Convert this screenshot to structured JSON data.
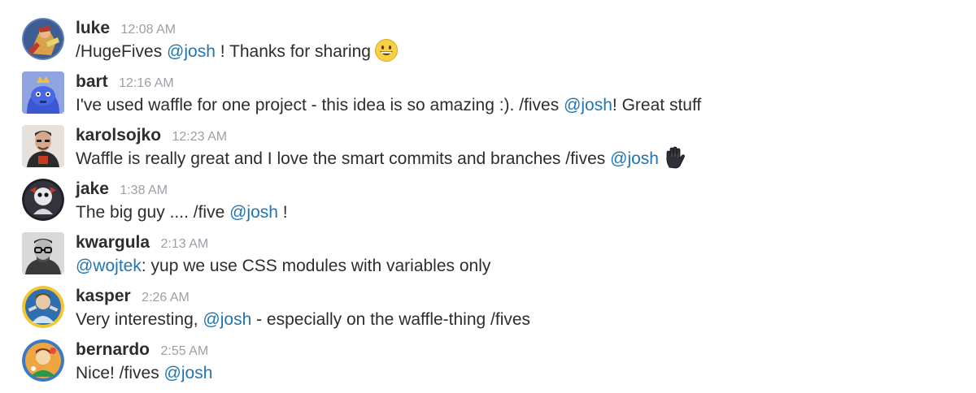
{
  "messages": [
    {
      "username": "luke",
      "time": "12:08 AM",
      "parts": [
        "/HugeFives ",
        "@josh",
        " ! Thanks for sharing"
      ],
      "emoji": "grinning-face-emoji"
    },
    {
      "username": "bart",
      "time": "12:16 AM",
      "parts": [
        "I've used waffle for one project - this idea is so amazing :). /fives ",
        "@josh",
        "! Great stuff"
      ]
    },
    {
      "username": "karolsojko",
      "time": "12:23 AM",
      "parts": [
        "Waffle is really great and I love the smart commits and branches /fives ",
        "@josh"
      ],
      "emoji": "raised-hand-emoji"
    },
    {
      "username": "jake",
      "time": "1:38 AM",
      "parts": [
        "The big guy .... /five ",
        "@josh",
        " !"
      ]
    },
    {
      "username": "kwargula",
      "time": "2:13 AM",
      "parts": [
        "@wojtek",
        ": yup we use CSS modules with variables only"
      ]
    },
    {
      "username": "kasper",
      "time": "2:26 AM",
      "parts": [
        "Very interesting, ",
        "@josh",
        " - especially on the waffle-thing /fives"
      ]
    },
    {
      "username": "bernardo",
      "time": "2:55 AM",
      "parts": [
        "Nice! /fives ",
        "@josh"
      ]
    }
  ],
  "colors": {
    "username": "#2c2d30",
    "timestamp": "#9e9ea6",
    "mention": "#1f75b4",
    "text": "#2c2d30"
  }
}
